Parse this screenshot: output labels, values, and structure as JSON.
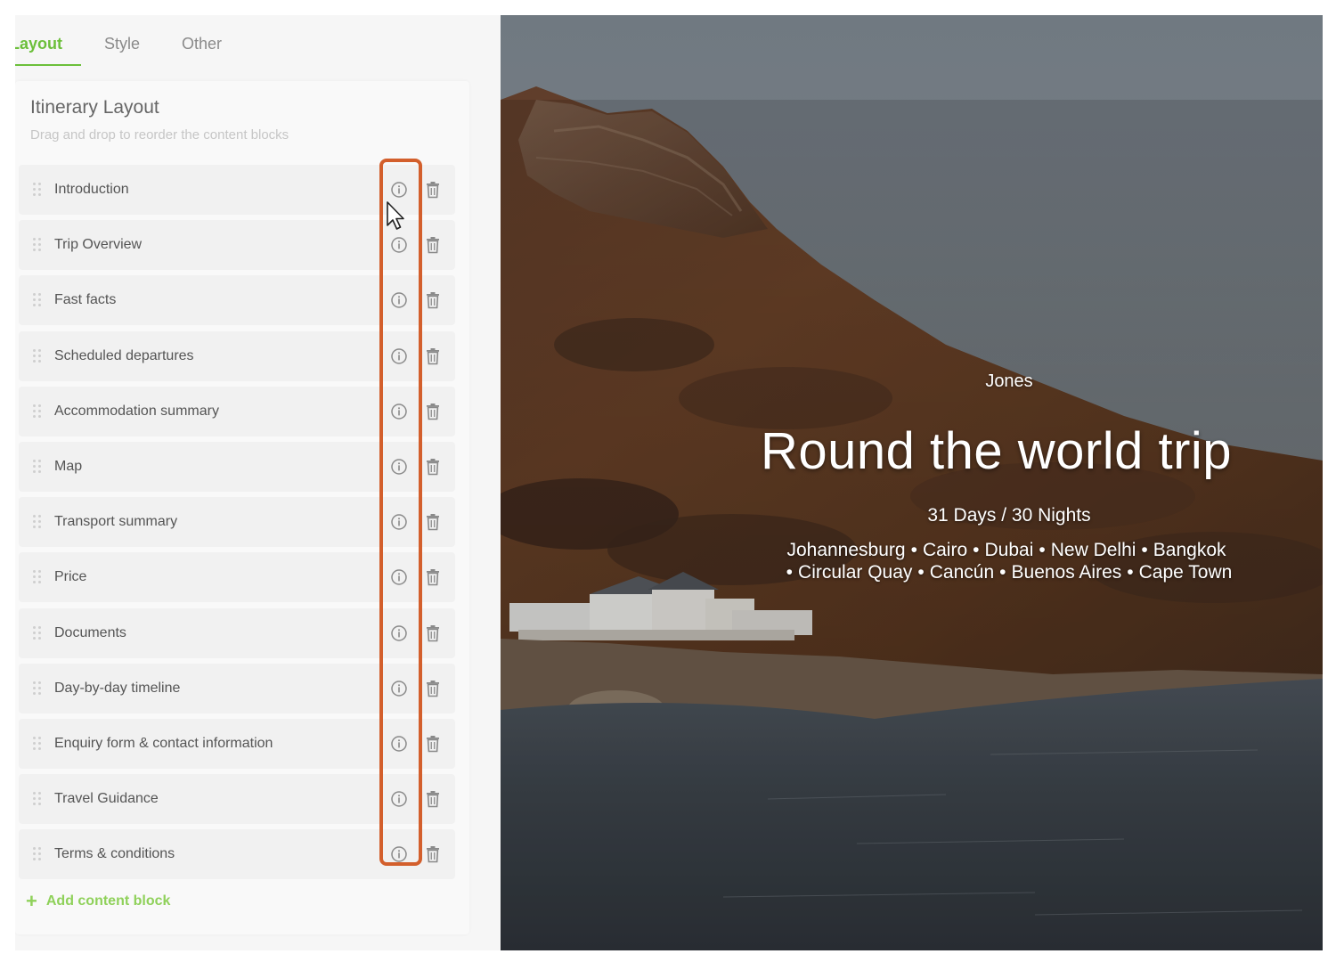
{
  "tabs": [
    {
      "label": "Layout",
      "active": true
    },
    {
      "label": "Style",
      "active": false
    },
    {
      "label": "Other",
      "active": false
    }
  ],
  "panel": {
    "title": "Itinerary Layout",
    "subtitle": "Drag and drop to reorder the content blocks",
    "add_label": "Add content block"
  },
  "blocks": [
    {
      "label": "Introduction",
      "info_icon": "info-icon",
      "delete_icon": "trash-icon"
    },
    {
      "label": "Trip Overview",
      "info_icon": "info-icon",
      "delete_icon": "trash-icon"
    },
    {
      "label": "Fast facts",
      "info_icon": "info-icon",
      "delete_icon": "trash-icon"
    },
    {
      "label": "Scheduled departures",
      "info_icon": "info-icon",
      "delete_icon": "trash-icon"
    },
    {
      "label": "Accommodation summary",
      "info_icon": "info-icon",
      "delete_icon": "trash-icon"
    },
    {
      "label": "Map",
      "info_icon": "info-icon",
      "delete_icon": "trash-icon"
    },
    {
      "label": "Transport summary",
      "info_icon": "info-icon",
      "delete_icon": "trash-icon"
    },
    {
      "label": "Price",
      "info_icon": "info-icon",
      "delete_icon": "trash-icon"
    },
    {
      "label": "Documents",
      "info_icon": "info-icon",
      "delete_icon": "trash-icon"
    },
    {
      "label": "Day-by-day timeline",
      "info_icon": "info-icon",
      "delete_icon": "trash-icon"
    },
    {
      "label": "Enquiry form & contact information",
      "info_icon": "info-icon",
      "delete_icon": "trash-icon"
    },
    {
      "label": "Travel Guidance",
      "info_icon": "info-icon",
      "delete_icon": "trash-icon"
    },
    {
      "label": "Terms & conditions",
      "info_icon": "info-icon",
      "delete_icon": "trash-icon"
    }
  ],
  "preview": {
    "owner": "Jones",
    "title": "Round the world trip",
    "duration": "31 Days / 30 Nights",
    "destinations_line1": [
      "Johannesburg",
      "Cairo",
      "Dubai",
      "New Delhi",
      "Bangkok"
    ],
    "destinations_line2": [
      "Circular Quay",
      "Cancún",
      "Buenos Aires",
      "Cape Town"
    ]
  },
  "colors": {
    "accent": "#6bbf3a",
    "add_link": "#8fd15a",
    "highlight": "#d35f2c"
  }
}
